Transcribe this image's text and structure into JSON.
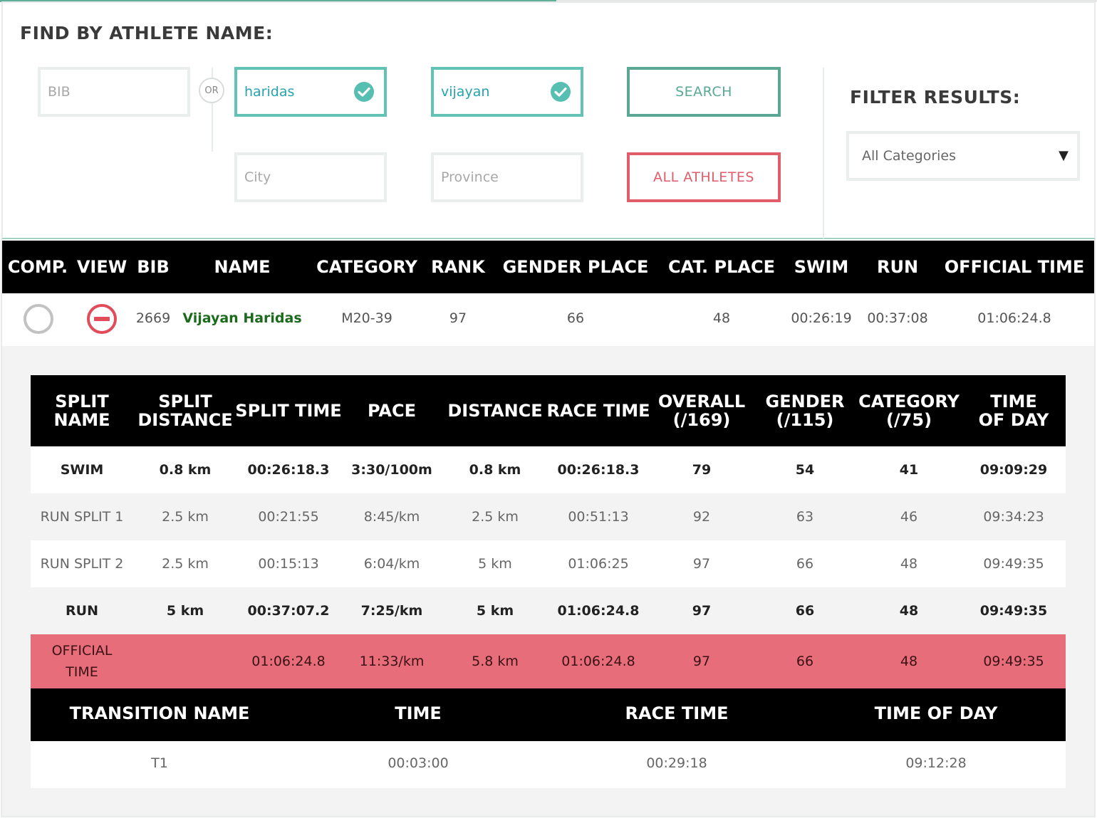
{
  "search": {
    "title": "FIND BY ATHLETE NAME:",
    "bib_placeholder": "BIB",
    "or_label": "OR",
    "first_name_value": "haridas",
    "last_name_value": "vijayan",
    "city_placeholder": "City",
    "province_placeholder": "Province",
    "search_button": "SEARCH",
    "all_athletes_button": "ALL ATHLETES"
  },
  "filter": {
    "title": "FILTER RESULTS:",
    "selected_category": "All Categories",
    "caret": "▼"
  },
  "results": {
    "headers": [
      "COMP.",
      "VIEW",
      "BIB",
      "NAME",
      "CATEGORY",
      "RANK",
      "GENDER PLACE",
      "CAT. PLACE",
      "SWIM",
      "RUN",
      "OFFICIAL TIME"
    ],
    "row": {
      "bib": "2669",
      "name": "Vijayan Haridas",
      "category": "M20-39",
      "rank": "97",
      "gender_place": "66",
      "cat_place": "48",
      "swim": "00:26:19",
      "run": "00:37:08",
      "official_time": "01:06:24.8"
    }
  },
  "splits": {
    "headers": [
      "SPLIT NAME",
      "SPLIT DISTANCE",
      "SPLIT TIME",
      "PACE",
      "DISTANCE",
      "RACE TIME",
      "OVERALL (/169)",
      "GENDER (/115)",
      "CATEGORY (/75)",
      "TIME OF DAY"
    ],
    "rows": [
      [
        "SWIM",
        "0.8 km",
        "00:26:18.3",
        "3:30/100m",
        "0.8 km",
        "00:26:18.3",
        "79",
        "54",
        "41",
        "09:09:29"
      ],
      [
        "RUN SPLIT 1",
        "2.5 km",
        "00:21:55",
        "8:45/km",
        "2.5 km",
        "00:51:13",
        "92",
        "63",
        "46",
        "09:34:23"
      ],
      [
        "RUN SPLIT 2",
        "2.5 km",
        "00:15:13",
        "6:04/km",
        "5 km",
        "01:06:25",
        "97",
        "66",
        "48",
        "09:49:35"
      ],
      [
        "RUN",
        "5 km",
        "00:37:07.2",
        "7:25/km",
        "5 km",
        "01:06:24.8",
        "97",
        "66",
        "48",
        "09:49:35"
      ],
      [
        "OFFICIAL TIME",
        "",
        "01:06:24.8",
        "11:33/km",
        "5.8 km",
        "01:06:24.8",
        "97",
        "66",
        "48",
        "09:49:35"
      ]
    ]
  },
  "transitions": {
    "headers": [
      "TRANSITION NAME",
      "TIME",
      "RACE TIME",
      "TIME OF DAY"
    ],
    "rows": [
      [
        "T1",
        "00:03:00",
        "00:29:18",
        "09:12:28"
      ]
    ]
  }
}
